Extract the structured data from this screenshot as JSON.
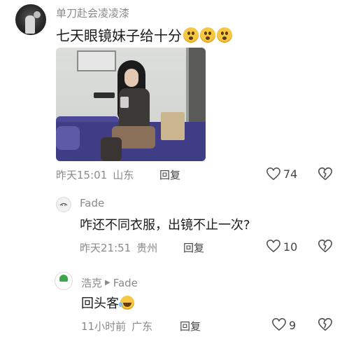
{
  "main_comment": {
    "author": "单刀赴会凌凌漆",
    "text": "七天眼镜妹子给十分",
    "time": "昨天15:01",
    "location": "山东",
    "reply_label": "回复",
    "likes": "74"
  },
  "replies": [
    {
      "author": "Fade",
      "text": "咋还不同衣服，出镜不止一次?",
      "time": "昨天21:51",
      "location": "贵州",
      "reply_label": "回复",
      "likes": "10"
    },
    {
      "author": "浩克",
      "reply_to": "Fade",
      "text": "回头客",
      "time": "11小时前",
      "location": "广东",
      "reply_label": "回复",
      "likes": "9"
    }
  ],
  "icons": {
    "like": "heart-outline-icon",
    "dislike": "broken-heart-icon",
    "reply_arrow": "play-triangle-icon",
    "emoji_main": "clapping-face-emoji",
    "emoji_reply": "laughing-tears-emoji"
  },
  "colors": {
    "meta_text": "#8a8a8a",
    "body_text": "#1a1a1a",
    "icon_stroke": "#555555"
  }
}
